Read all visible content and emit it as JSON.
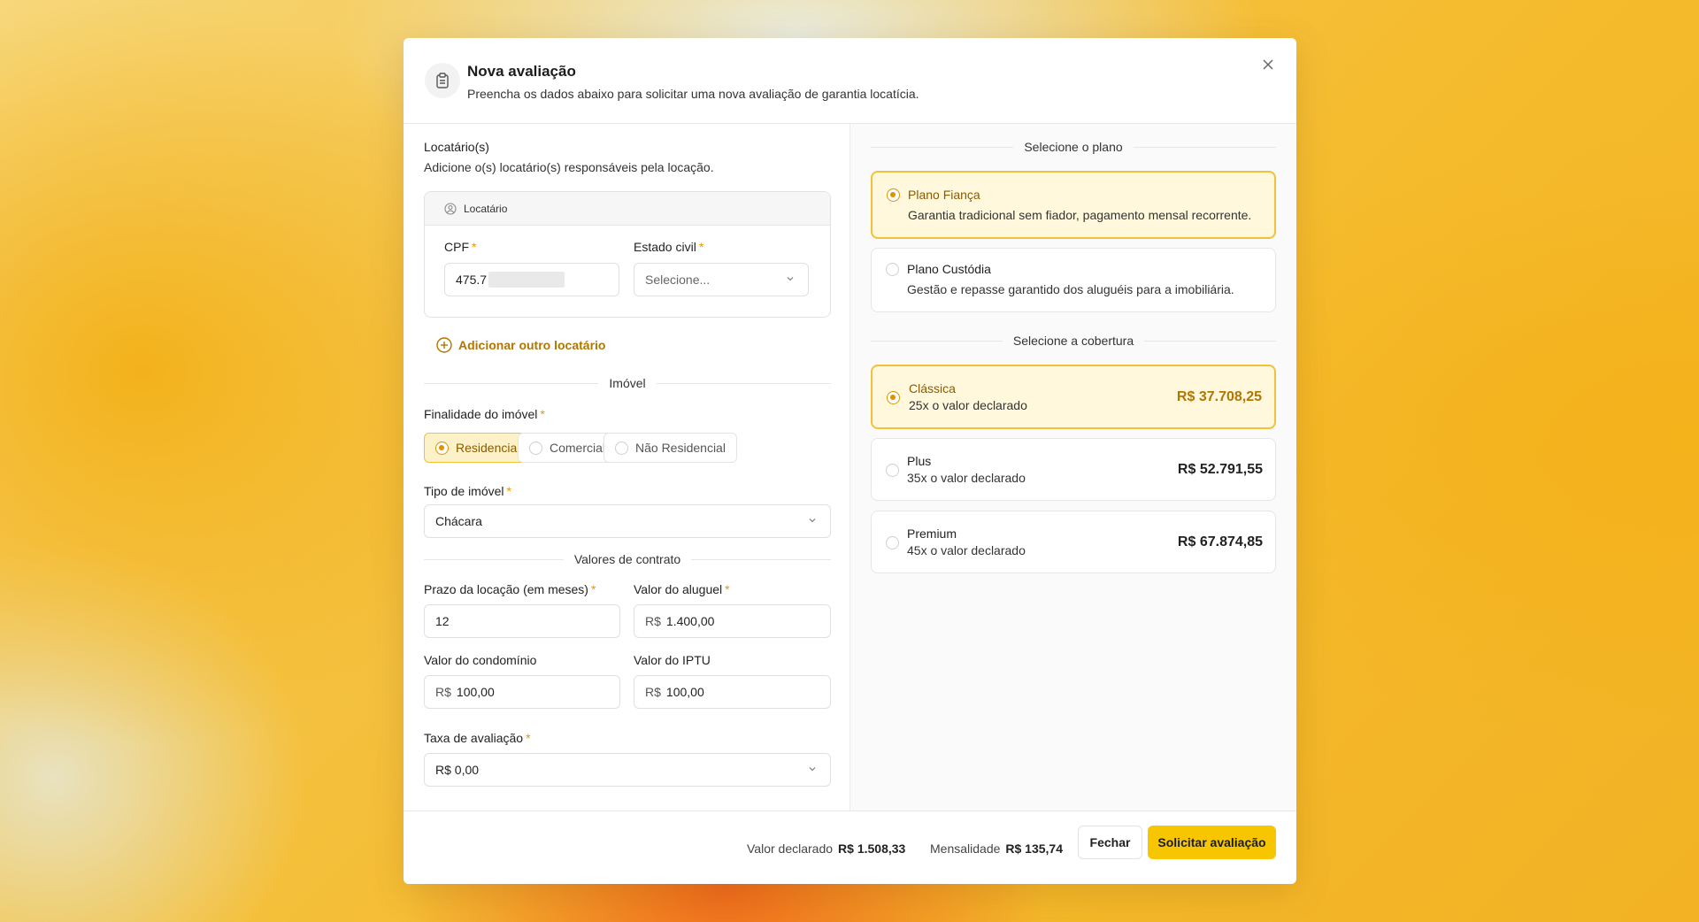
{
  "modal": {
    "title": "Nova avaliação",
    "subtitle": "Preencha os dados abaixo para solicitar uma nova avaliação de garantia locatícia."
  },
  "locatarios": {
    "section_title": "Locatário(s)",
    "section_desc": "Adicione o(s) locatário(s) responsáveis pela locação.",
    "card_title": "Locatário",
    "cpf_label": "CPF",
    "cpf_value": "475.7",
    "estado_civil_label": "Estado civil",
    "estado_civil_placeholder": "Selecione...",
    "add_label": "Adicionar outro locatário"
  },
  "imovel": {
    "section_title": "Imóvel",
    "finalidade_label": "Finalidade do imóvel",
    "finalidade_options": [
      "Residencial",
      "Comercial",
      "Não Residencial"
    ],
    "finalidade_selected": "Residencial",
    "tipo_label": "Tipo de imóvel",
    "tipo_value": "Chácara"
  },
  "contrato": {
    "section_title": "Valores de contrato",
    "prazo_label": "Prazo da locação (em meses)",
    "prazo_value": "12",
    "aluguel_label": "Valor do aluguel",
    "aluguel_value": "1.400,00",
    "condominio_label": "Valor do condomínio",
    "condominio_value": "100,00",
    "iptu_label": "Valor do IPTU",
    "iptu_value": "100,00",
    "currency_prefix": "R$",
    "taxa_label": "Taxa de avaliação",
    "taxa_value": "R$ 0,00"
  },
  "planos": {
    "section_title": "Selecione o plano",
    "items": [
      {
        "name": "Plano Fiança",
        "desc": "Garantia tradicional sem fiador, pagamento mensal recorrente.",
        "selected": true
      },
      {
        "name": "Plano Custódia",
        "desc": "Gestão e repasse garantido dos aluguéis para a imobiliária.",
        "selected": false
      }
    ]
  },
  "coberturas": {
    "section_title": "Selecione a cobertura",
    "items": [
      {
        "name": "Clássica",
        "desc": "25x o valor declarado",
        "price": "R$ 37.708,25",
        "selected": true
      },
      {
        "name": "Plus",
        "desc": "35x o valor declarado",
        "price": "R$ 52.791,55",
        "selected": false
      },
      {
        "name": "Premium",
        "desc": "45x o valor declarado",
        "price": "R$ 67.874,85",
        "selected": false
      }
    ]
  },
  "footer": {
    "valor_declarado_label": "Valor declarado",
    "valor_declarado_value": "R$ 1.508,33",
    "mensalidade_label": "Mensalidade",
    "mensalidade_value": "R$ 135,74",
    "fechar_label": "Fechar",
    "solicitar_label": "Solicitar avaliação"
  },
  "colors": {
    "accent": "#f7c600",
    "accent_text": "#b07600",
    "selected_bg": "#fff8dc",
    "selected_border": "#f2c13a"
  }
}
